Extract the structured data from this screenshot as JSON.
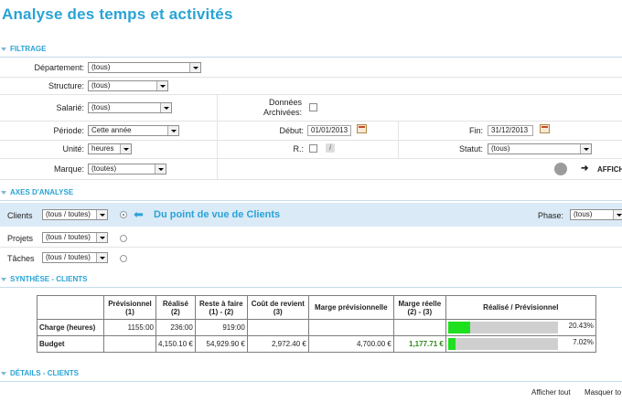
{
  "page": {
    "title": "Analyse des temps et activités"
  },
  "sections": {
    "filtrage": "FILTRAGE",
    "axes": "AXES D'ANALYSE",
    "synthese": "SYNTHÈSE - CLIENTS",
    "details": "DÉTAILS - CLIENTS"
  },
  "filters": {
    "departement": {
      "label": "Département:",
      "value": "(tous)"
    },
    "structure": {
      "label": "Structure:",
      "value": "(tous)"
    },
    "salarie": {
      "label": "Salarié:",
      "value": "(tous)"
    },
    "donnees_archivees": {
      "label_line1": "Données",
      "label_line2": "Archivées:"
    },
    "periode": {
      "label": "Période:",
      "value": "Cette année"
    },
    "debut": {
      "label": "Début:",
      "value": "01/01/2013"
    },
    "fin": {
      "label": "Fin:",
      "value": "31/12/2013"
    },
    "unite": {
      "label": "Unité:",
      "value": "heures"
    },
    "r": {
      "label": "R.:",
      "info_glyph": "i"
    },
    "statut": {
      "label": "Statut:",
      "value": "(tous)"
    },
    "marque": {
      "label": "Marque:",
      "value": "(toutes)"
    },
    "afficher_label": "AFFICH"
  },
  "axes": {
    "clients": {
      "label": "Clients",
      "value": "(tous / toutes)"
    },
    "projets": {
      "label": "Projets",
      "value": "(tous / toutes)"
    },
    "taches": {
      "label": "Tâches",
      "value": "(tous / toutes)"
    },
    "point_de_vue": "Du point de vue de Clients",
    "phase": {
      "label": "Phase:",
      "value": "(tous)"
    }
  },
  "synthese": {
    "headers": [
      {
        "l1": "Prévisionnel",
        "l2": "(1)"
      },
      {
        "l1": "Réalisé",
        "l2": "(2)"
      },
      {
        "l1": "Reste à faire",
        "l2": "(1) - (2)"
      },
      {
        "l1": "Coût de revient",
        "l2": "(3)"
      },
      {
        "l1": "Marge prévisionnelle",
        "l2": ""
      },
      {
        "l1": "Marge réelle",
        "l2": "(2) - (3)"
      },
      {
        "l1": "Réalisé / Prévisionnel",
        "l2": ""
      }
    ],
    "rows": [
      {
        "label": "Charge (heures)",
        "prev": "1155:00",
        "real": "236:00",
        "reste": "919:00",
        "cout": "",
        "marge_prev": "",
        "marge_reelle": "",
        "ratio": 0.2043,
        "pct": "20.43%"
      },
      {
        "label": "Budget",
        "prev": "",
        "real": "4,150.10 €",
        "reste": "54,929.90 €",
        "cout": "2,972.40 €",
        "marge_prev": "4,700.00 €",
        "marge_reelle": "1,177.71 €",
        "ratio": 0.0702,
        "pct": "7.02%"
      }
    ]
  },
  "details": {
    "show_all": "Afficher tout",
    "hide_all": "Masquer to"
  },
  "colors": {
    "accent": "#29a3d6",
    "highlight_row": "#dbeaf7",
    "bar_fill": "#1ee01e",
    "bar_bg": "#cfcfcf",
    "positive": "#2e8b1a"
  }
}
